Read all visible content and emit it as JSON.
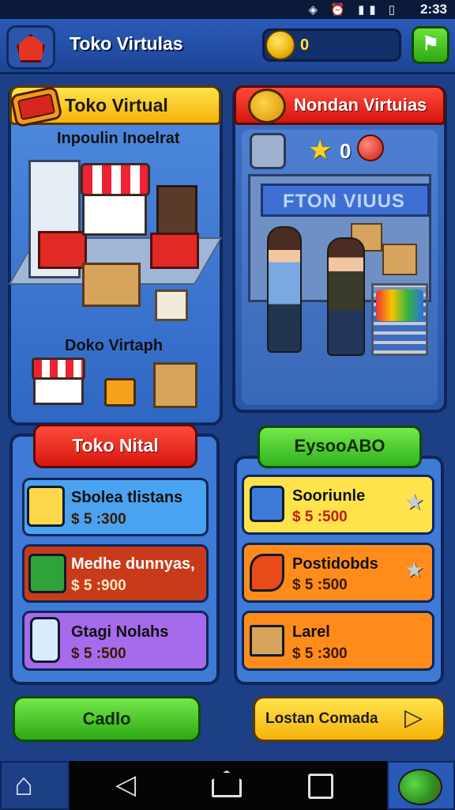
{
  "status_bar": {
    "time": "2:33",
    "icons": [
      "wifi-icon",
      "alarm-icon",
      "signal-icon",
      "battery-icon"
    ]
  },
  "header": {
    "title": "Toko Virtulas",
    "coins": "0",
    "action_icon": "flag-icon"
  },
  "left_panel": {
    "title": "Toko Virtual",
    "caption_top": "Inpoulin Inoelrat",
    "caption_bottom": "Doko Virtaph",
    "section_button": "Toko Nital",
    "items": [
      {
        "name": "Sbolea tlistans",
        "price": "$ 5 :300",
        "icon": "clipboard-icon",
        "color": "#4aa3f0"
      },
      {
        "name": "Medhe dunnyas,",
        "price": "$ 5 :900",
        "icon": "money-bag-icon",
        "color": "#c83b1a"
      },
      {
        "name": "Gtagi Nolahs",
        "price": "$ 5 :500",
        "icon": "phone-icon",
        "color": "#a56bea"
      }
    ],
    "cta": "Cadlo"
  },
  "right_panel": {
    "title": "Nondan Virtuias",
    "stat_value": "0",
    "shop_sign": "FTON VIUUS",
    "section_button": "EysooABO",
    "items": [
      {
        "name": "Sooriunle",
        "price": "$ 5 :500",
        "icon": "document-pen-icon",
        "color": "#ffe34a"
      },
      {
        "name": "Postidobds",
        "price": "$ 5 :500",
        "icon": "carrot-icon",
        "color": "#ff8c1a"
      },
      {
        "name": "Larel",
        "price": "$ 5 :300",
        "icon": "box-icon",
        "color": "#ff8c1a"
      }
    ],
    "cta": "Lostan Comada"
  },
  "nav_bar": {
    "buttons": [
      "home-icon",
      "back-icon",
      "home-button-icon",
      "recent-apps-icon",
      "avatar-icon"
    ]
  }
}
